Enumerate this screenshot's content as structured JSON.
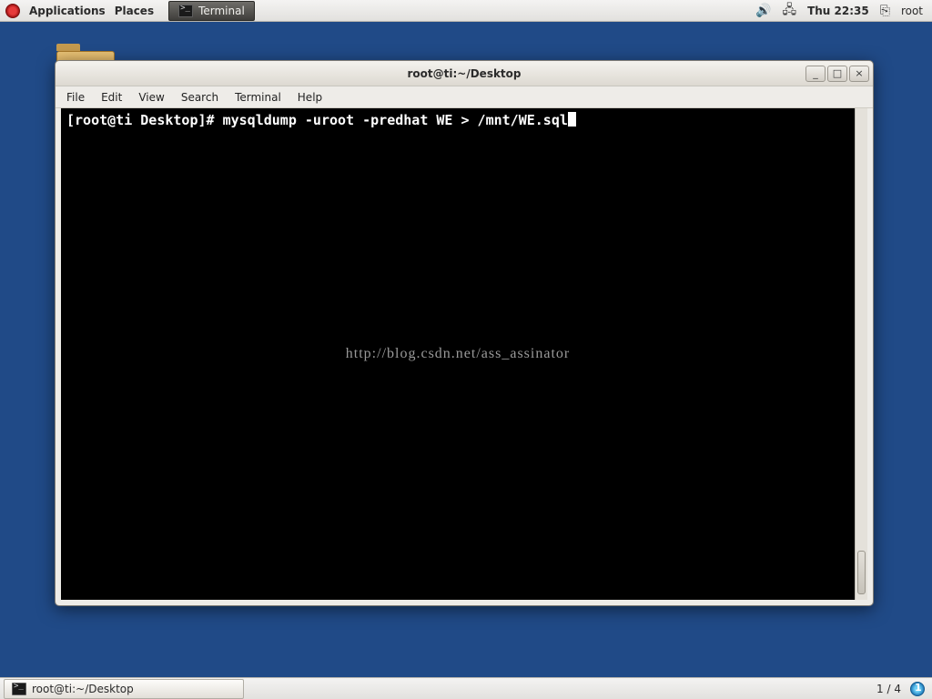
{
  "top_panel": {
    "applications": "Applications",
    "places": "Places",
    "task_label": "Terminal",
    "clock": "Thu 22:35",
    "user": "root"
  },
  "window": {
    "title": "root@ti:~/Desktop",
    "menus": {
      "file": "File",
      "edit": "Edit",
      "view": "View",
      "search": "Search",
      "terminal": "Terminal",
      "help": "Help"
    },
    "controls": {
      "min": "_",
      "max": "□",
      "close": "×"
    }
  },
  "terminal": {
    "prompt": "[root@ti Desktop]# ",
    "command": "mysqldump -uroot -predhat WE > /mnt/WE.sql",
    "watermark": "http://blog.csdn.net/ass_assinator"
  },
  "bottom_panel": {
    "task_label": "root@ti:~/Desktop",
    "workspace": "1 / 4"
  }
}
